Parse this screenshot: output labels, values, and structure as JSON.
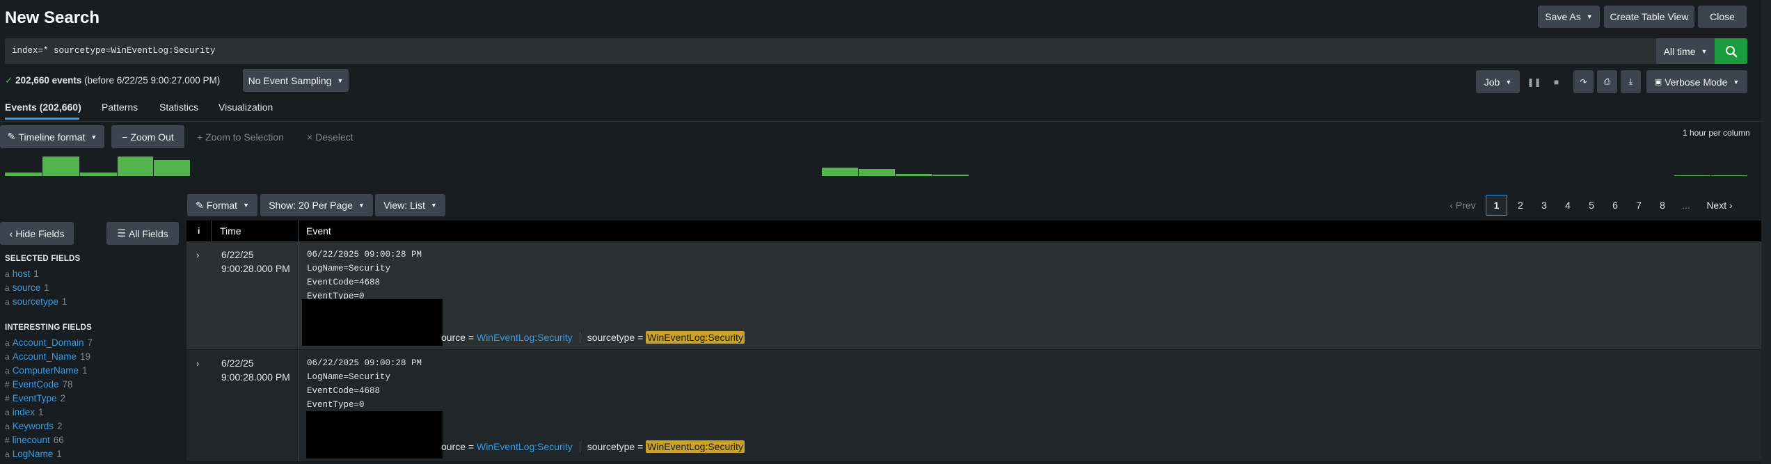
{
  "header": {
    "title": "New Search",
    "save_as": "Save As",
    "create_table_view": "Create Table View",
    "close": "Close"
  },
  "search": {
    "query": "index=* sourcetype=WinEventLog:Security",
    "time_range": "All time"
  },
  "status": {
    "check": "✓",
    "events_count": "202,660 events",
    "before": "(before 6/22/25 9:00:27.000 PM)",
    "sampling": "No Event Sampling"
  },
  "job": {
    "job_label": "Job",
    "mode": "Verbose Mode"
  },
  "tabs": [
    {
      "label": "Events (202,660)"
    },
    {
      "label": "Patterns"
    },
    {
      "label": "Statistics"
    },
    {
      "label": "Visualization"
    }
  ],
  "timeline": {
    "format": "Timeline format",
    "zoom_out": "Zoom Out",
    "zoom_to_selection": "Zoom to Selection",
    "deselect": "Deselect",
    "per_column": "1 hour per column"
  },
  "results_toolbar": {
    "format": "Format",
    "per_page": "Show: 20 Per Page",
    "view": "View: List"
  },
  "pagination": {
    "prev": "Prev",
    "pages": [
      "1",
      "2",
      "3",
      "4",
      "5",
      "6",
      "7",
      "8"
    ],
    "ellipsis": "...",
    "next": "Next",
    "current": "1"
  },
  "sidebar": {
    "hide_fields": "Hide Fields",
    "all_fields": "All Fields",
    "selected_heading": "SELECTED FIELDS",
    "selected_fields": [
      {
        "type": "a",
        "name": "host",
        "count": "1"
      },
      {
        "type": "a",
        "name": "source",
        "count": "1"
      },
      {
        "type": "a",
        "name": "sourcetype",
        "count": "1"
      }
    ],
    "interesting_heading": "INTERESTING FIELDS",
    "interesting_fields": [
      {
        "type": "a",
        "name": "Account_Domain",
        "count": "7"
      },
      {
        "type": "a",
        "name": "Account_Name",
        "count": "19"
      },
      {
        "type": "a",
        "name": "ComputerName",
        "count": "1"
      },
      {
        "type": "#",
        "name": "EventCode",
        "count": "78"
      },
      {
        "type": "#",
        "name": "EventType",
        "count": "2"
      },
      {
        "type": "a",
        "name": "index",
        "count": "1"
      },
      {
        "type": "a",
        "name": "Keywords",
        "count": "2"
      },
      {
        "type": "#",
        "name": "linecount",
        "count": "66"
      },
      {
        "type": "a",
        "name": "LogName",
        "count": "1"
      }
    ]
  },
  "table": {
    "col_info": "i",
    "col_time": "Time",
    "col_event": "Event",
    "rows": [
      {
        "date": "6/22/25",
        "time": "9:00:28.000 PM",
        "lines": [
          "06/22/2025 09:00:28 PM",
          "LogName=Security",
          "EventCode=4688",
          "EventType=0"
        ],
        "source_label": "ource =",
        "source_value": "WinEventLog:Security",
        "sourcetype_label": "sourcetype =",
        "sourcetype_value": "WinEventLog:Security"
      },
      {
        "date": "6/22/25",
        "time": "9:00:28.000 PM",
        "lines": [
          "06/22/2025 09:00:28 PM",
          "LogName=Security",
          "EventCode=4688",
          "EventType=0"
        ],
        "source_label": "ource =",
        "source_value": "WinEventLog:Security",
        "sourcetype_label": "sourcetype =",
        "sourcetype_value": "WinEventLog:Security"
      }
    ]
  },
  "colors": {
    "background": "#171d21",
    "accent_blue": "#3c9be0",
    "search_green": "#1a9c3e",
    "timeline_green": "#53b44e",
    "highlight": "#c9a227"
  }
}
